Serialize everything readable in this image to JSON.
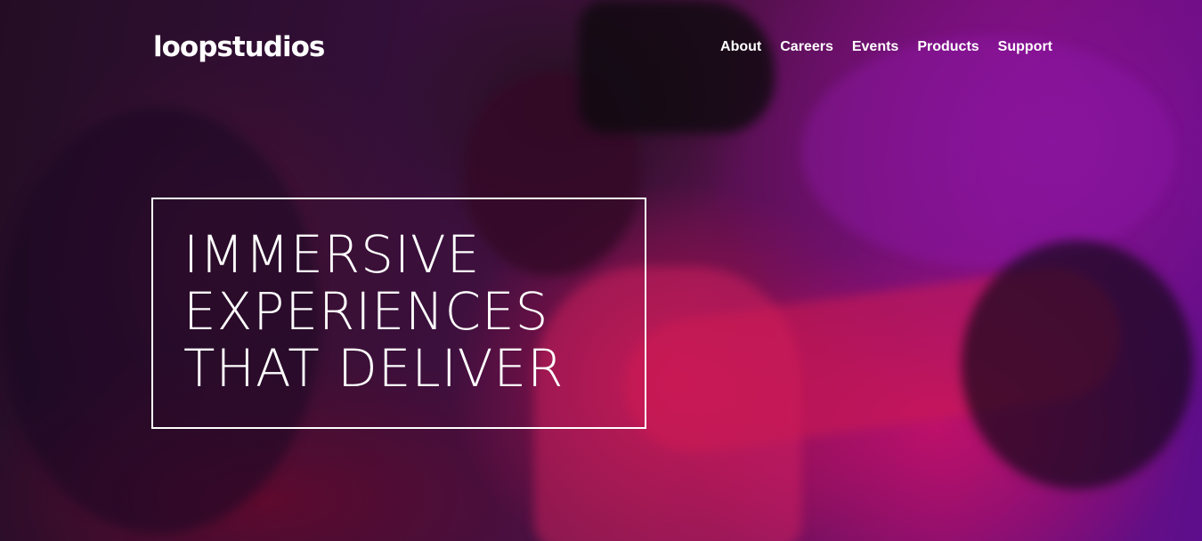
{
  "brand": {
    "logo": "loopstudios"
  },
  "nav": {
    "items": [
      {
        "label": "About"
      },
      {
        "label": "Careers"
      },
      {
        "label": "Events"
      },
      {
        "label": "Products"
      },
      {
        "label": "Support"
      }
    ]
  },
  "hero": {
    "headline_lines": [
      "IMMERSIVE",
      "EXPERIENCES",
      "THAT DELIVER"
    ]
  },
  "colors": {
    "text": "#ffffff",
    "accent_magenta": "#e0147a",
    "accent_purple": "#8a11a0"
  }
}
